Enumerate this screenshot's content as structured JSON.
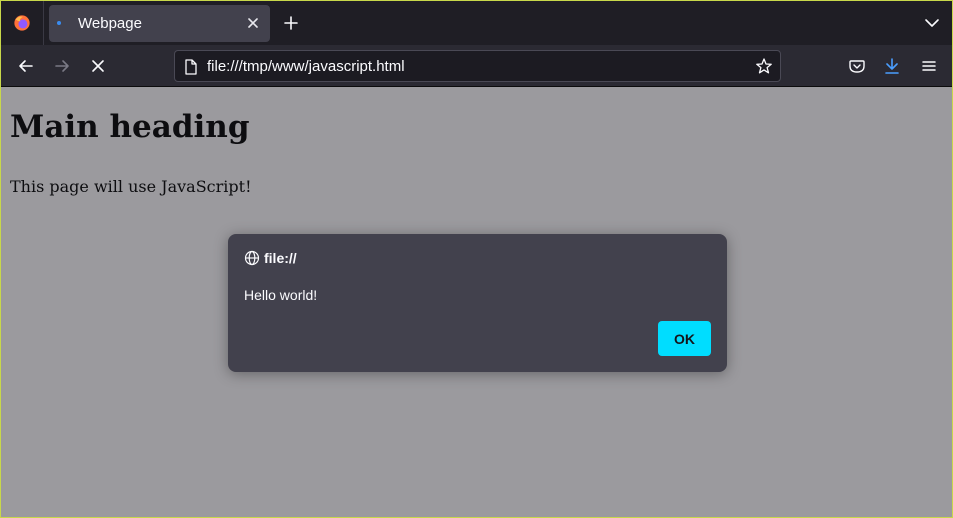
{
  "browser": {
    "tab": {
      "title": "Webpage"
    },
    "urlbar": {
      "url": "file:///tmp/www/javascript.html"
    }
  },
  "page": {
    "heading": "Main heading",
    "text": "This page will use JavaScript!"
  },
  "dialog": {
    "origin": "file://",
    "message": "Hello world!",
    "ok_label": "OK"
  },
  "colors": {
    "accent": "#00ddff",
    "page_dimmed_bg": "#9b9a9e",
    "dialog_bg": "#42414d",
    "frame_bg": "#1f1e25"
  },
  "icons": [
    "firefox-logo-icon",
    "close-icon",
    "plus-icon",
    "chevron-down-icon",
    "arrow-left-icon",
    "arrow-right-icon",
    "stop-icon",
    "page-icon",
    "star-icon",
    "pocket-icon",
    "download-icon",
    "menu-icon",
    "globe-icon"
  ]
}
